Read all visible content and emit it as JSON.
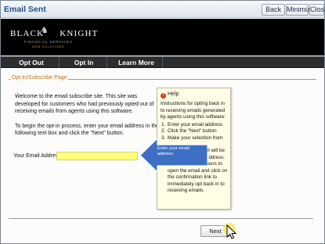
{
  "window": {
    "title": "Email Sent",
    "buttons": {
      "back": "Back",
      "minimize": "Minimize",
      "close": "Close"
    }
  },
  "brand": {
    "name_left": "BLACK",
    "name_right": "KNIGHT",
    "subtitle": "FINANCIAL SERVICES",
    "division": "WEB SOLUTIONS"
  },
  "nav": {
    "items": [
      "Opt Out",
      "Opt In",
      "Learn More"
    ]
  },
  "page": {
    "legend": "Opt In/Subscribe Page",
    "intro_1": "Welcome to the email subscribe site. This site was developed for customers who had previously opted out of receiving emails from agents using this software.",
    "intro_2": "To begin the opt-in process, enter your email address in the following text box and click the \"Next\" button.",
    "email_label": "Your Email Address:",
    "email_value": "",
    "next_label": "Next"
  },
  "help": {
    "title": "Help",
    "intro": "Instructions for opting back in to receiving emails generated by agents using this software:",
    "steps": [
      {
        "n": "1.",
        "text": "Enter your email address"
      },
      {
        "n": "2.",
        "text": "Click the \"Next\" button"
      },
      {
        "n": "3.",
        "text": "Make your selection from"
      }
    ],
    "fragment_1": "ail will be",
    "fragment_2": "ddress.",
    "tail": "You will have 72 hours to open the email and click on the confirmation link to immediately opt back in to receiving emails."
  },
  "callout": {
    "text": "Enter your email address"
  },
  "colors": {
    "title_text": "#1f4e8c",
    "legend": "#c0701c",
    "input_highlight": "#ffff75",
    "callout_fill": "#3d6fc4",
    "help_icon": "#d63820",
    "cursor_highlight": "#f5e663"
  }
}
